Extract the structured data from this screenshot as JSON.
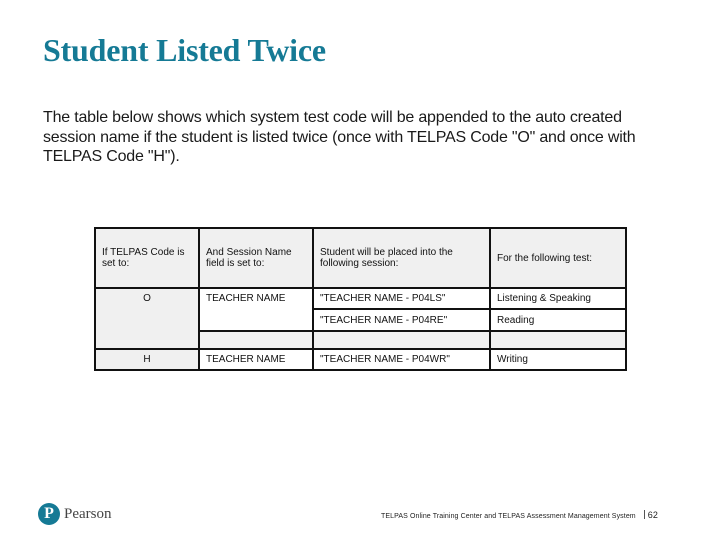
{
  "title": "Student Listed Twice",
  "intro": "The table below shows which system test code will be appended to the auto created session name if the student is listed twice (once with TELPAS Code \"O\" and once with TELPAS Code \"H\").",
  "table": {
    "headers": [
      "If TELPAS Code is set to:",
      "And Session Name field is set to:",
      "Student will be placed into the following session:",
      "For the following test:"
    ],
    "rows": [
      {
        "code": "O",
        "session_name": "TEACHER NAME",
        "placed_session": "\"TEACHER NAME - P04LS\"",
        "test": "Listening & Speaking"
      },
      {
        "code": "",
        "session_name": "",
        "placed_session": "\"TEACHER NAME - P04RE\"",
        "test": "Reading"
      },
      {
        "code": "H",
        "session_name": "TEACHER NAME",
        "placed_session": "\"TEACHER NAME - P04WR\"",
        "test": "Writing"
      }
    ]
  },
  "footer": {
    "logo_letter": "P",
    "logo_text": "Pearson",
    "text": "TELPAS Online Training Center and TELPAS Assessment Management System",
    "page": "62"
  },
  "colors": {
    "title": "#157a95",
    "header_bg": "#f0f0f0"
  }
}
